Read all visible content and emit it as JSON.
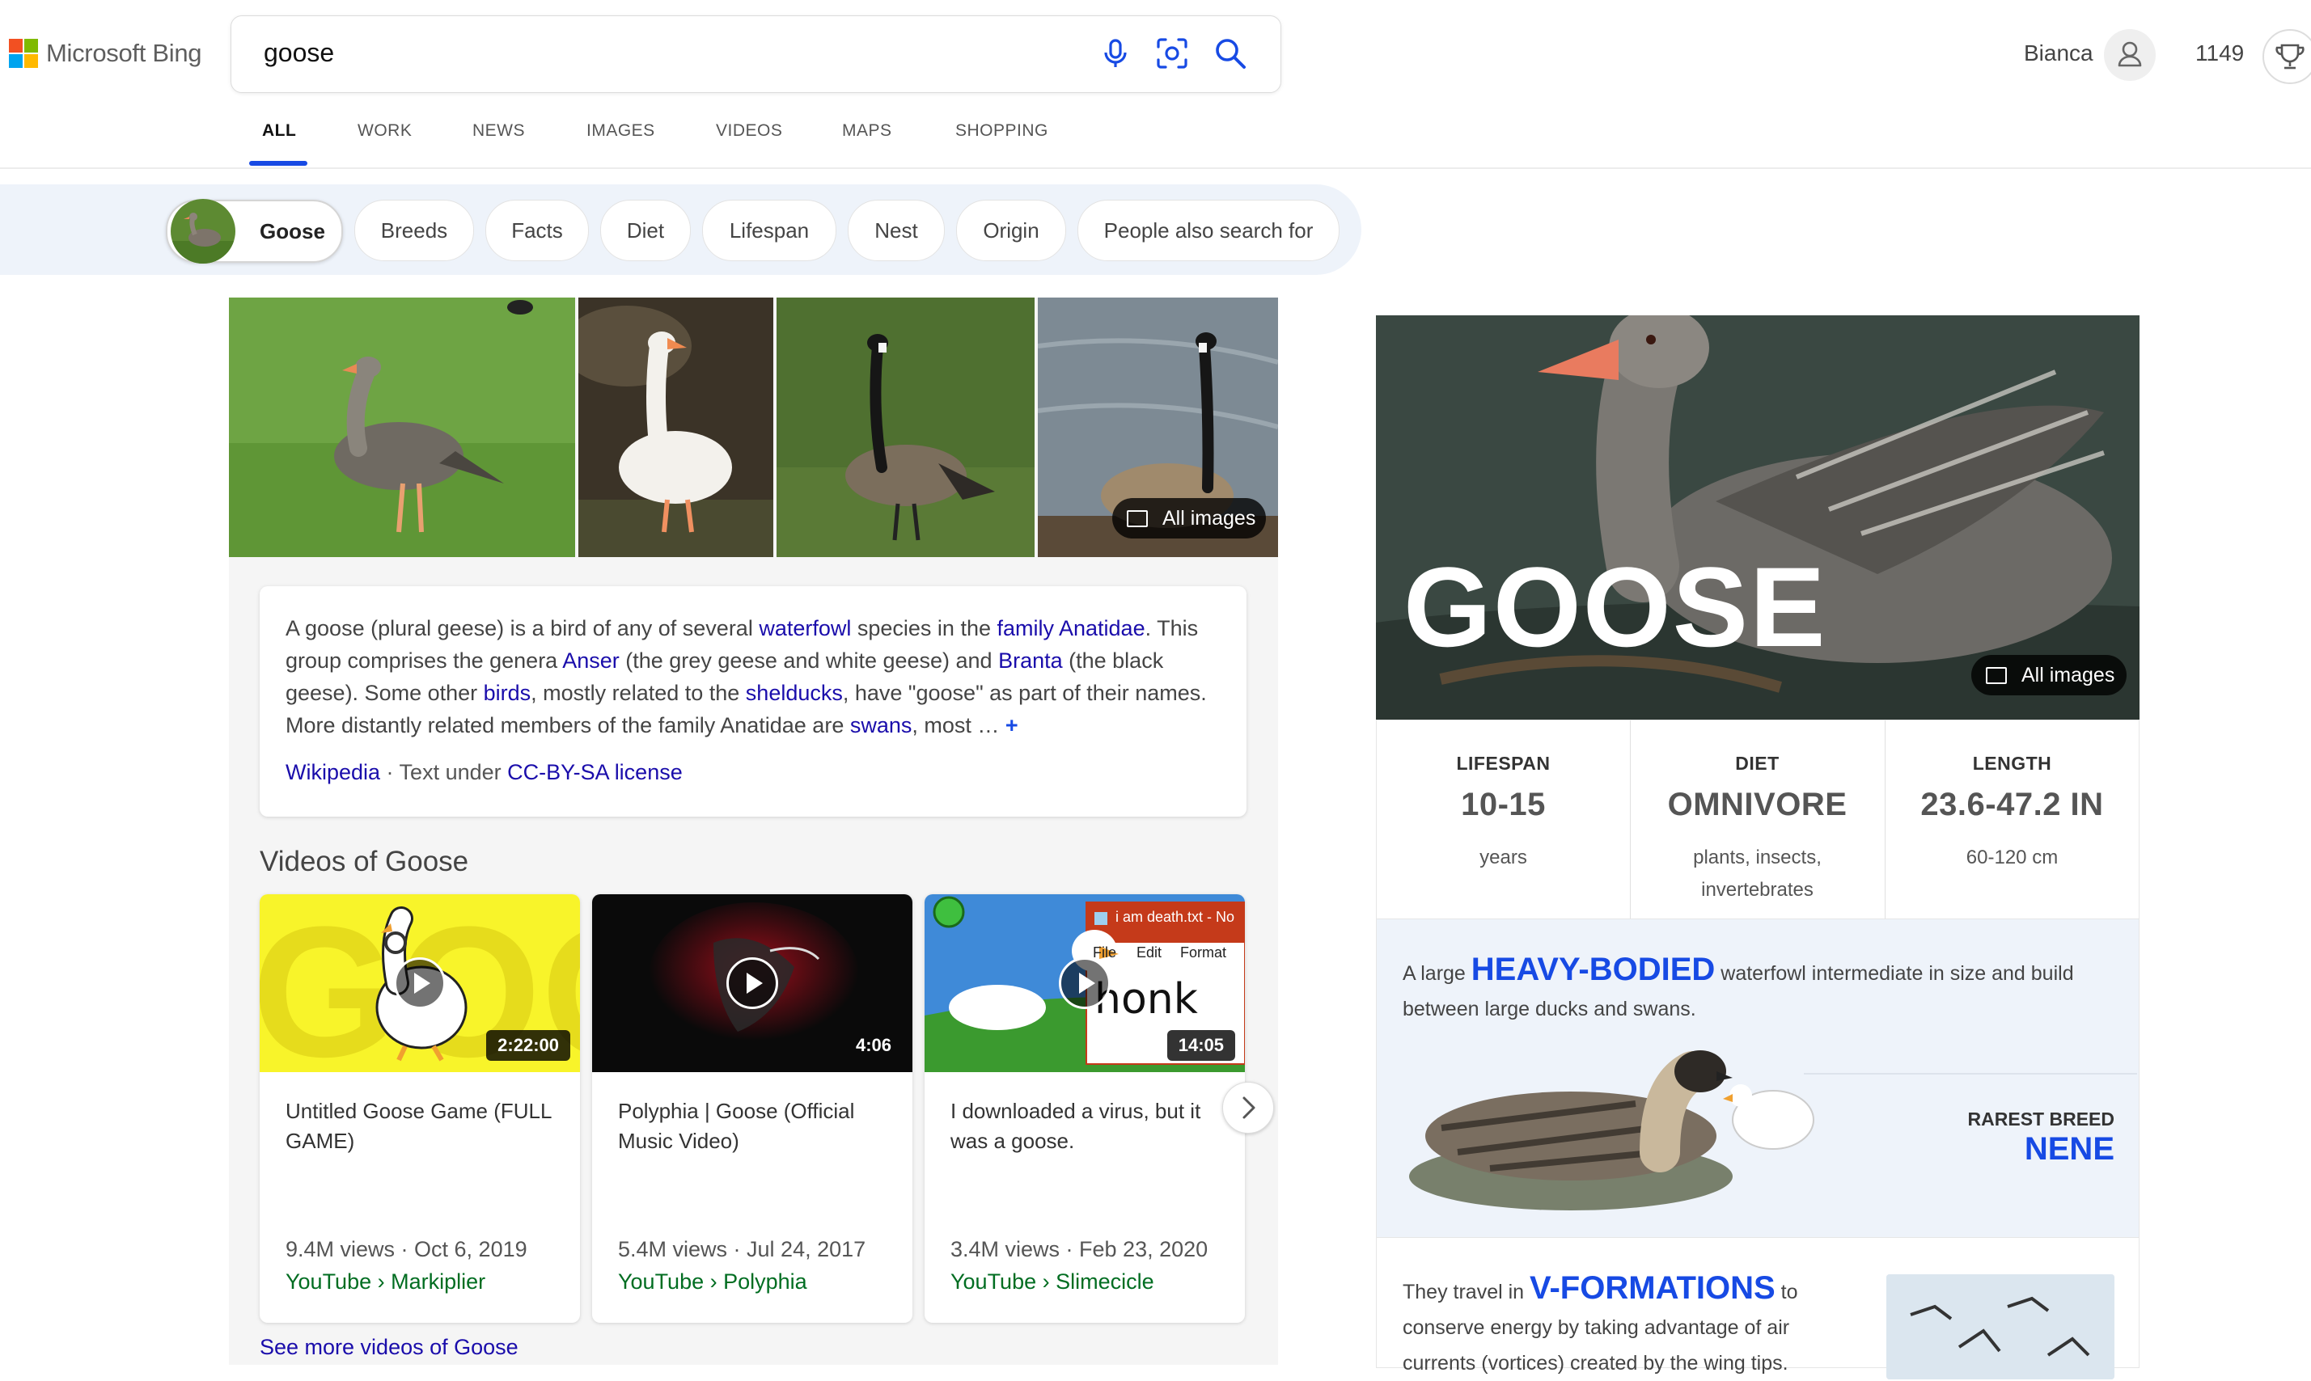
{
  "brand": {
    "logo_text": "Microsoft Bing",
    "logo_colors": [
      "#f25022",
      "#7fba00",
      "#00a4ef",
      "#ffb900"
    ]
  },
  "search": {
    "query": "goose"
  },
  "user": {
    "name": "Bianca",
    "points": "1149"
  },
  "nav_tabs": [
    "ALL",
    "WORK",
    "NEWS",
    "IMAGES",
    "VIDEOS",
    "MAPS",
    "SHOPPING"
  ],
  "active_tab": "ALL",
  "pills": [
    "Goose",
    "Breeds",
    "Facts",
    "Diet",
    "Lifespan",
    "Nest",
    "Origin",
    "People also search for"
  ],
  "images": {
    "all_images_label": "All images"
  },
  "description": {
    "t1": "A goose (plural geese) is a bird of any of several ",
    "l1": "waterfowl",
    "t2": " species in the ",
    "l2": "family Anatidae",
    "t3": ". This group comprises the genera ",
    "l3": "Anser",
    "t4": " (the grey geese and white geese) and ",
    "l4": "Branta",
    "t5": " (the black geese). Some other ",
    "l5": "birds",
    "t6": ", mostly related to the ",
    "l6": "shelducks",
    "t7": ", have \"goose\" as part of their names. More distantly related members of the family Anatidae are ",
    "l7": "swans",
    "t8": ", most … ",
    "expand": "+",
    "source_link": "Wikipedia",
    "source_sep": " · Text under ",
    "license_link": "CC-BY-SA license"
  },
  "videos": {
    "title": "Videos of Goose",
    "items": [
      {
        "title": "Untitled Goose Game (FULL GAME)",
        "duration": "2:22:00",
        "meta": "9.4M views · Oct 6, 2019",
        "source": "YouTube › Markiplier"
      },
      {
        "title": "Polyphia | Goose (Official Music Video)",
        "duration": "4:06",
        "meta": "5.4M views · Jul 24, 2017",
        "source": "YouTube › Polyphia"
      },
      {
        "title": "I downloaded a virus, but it was a goose.",
        "duration": "14:05",
        "meta": "3.4M views · Feb 23, 2020",
        "source": "YouTube › Slimecicle"
      }
    ],
    "thumb3_window_title": "i am death.txt - No",
    "thumb3_menu": [
      "File",
      "Edit",
      "Format"
    ],
    "thumb3_text": "honk",
    "see_more": "See more videos of Goose"
  },
  "panel": {
    "title": "GOOSE",
    "all_images_label": "All images",
    "facts": [
      {
        "label": "LIFESPAN",
        "value": "10-15",
        "sub": "years"
      },
      {
        "label": "DIET",
        "value": "OMNIVORE",
        "sub": "plants, insects, invertebrates"
      },
      {
        "label": "LENGTH",
        "value": "23.6-47.2 IN",
        "sub": "60-120 cm"
      }
    ],
    "heavy": {
      "pre": "A large ",
      "highlight": "HEAVY-BODIED",
      "post": " waterfowl intermediate in size and build between large ducks and swans."
    },
    "rarest": {
      "label": "RAREST BREED",
      "value": "NENE"
    },
    "travel": {
      "pre": "They travel in ",
      "highlight": "V-FORMATIONS",
      "post": " to conserve energy by taking advantage of air currents (vortices) created by the wing tips."
    }
  },
  "colors": {
    "accent": "#174ae4",
    "link": "#1a0dab",
    "source_green": "#006d21",
    "pill_bar": "#eef3fa"
  },
  "icons": [
    "microphone-icon",
    "visual-search-icon",
    "search-icon",
    "user-icon",
    "rewards-trophy-icon",
    "images-icon",
    "play-icon",
    "chevron-right-icon"
  ]
}
